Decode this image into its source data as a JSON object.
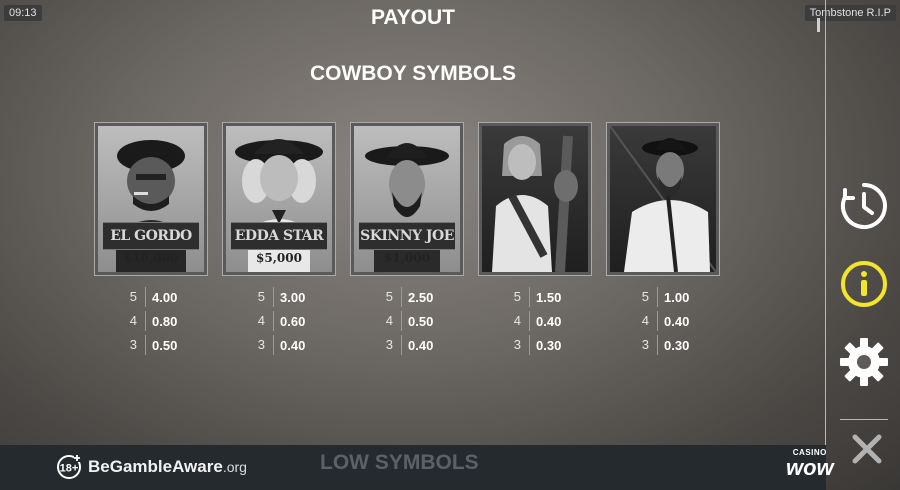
{
  "header": {
    "time": "09:13",
    "game_name": "Tombstone R.I.P",
    "title": "PAYOUT"
  },
  "section_title": "COWBOY SYMBOLS",
  "symbols": [
    {
      "name": "EL GORDO",
      "bounty": "$10,000",
      "pays": [
        {
          "count": "5",
          "value": "4.00"
        },
        {
          "count": "4",
          "value": "0.80"
        },
        {
          "count": "3",
          "value": "0.50"
        }
      ]
    },
    {
      "name": "EDDA STAR",
      "bounty": "$5,000",
      "pays": [
        {
          "count": "5",
          "value": "3.00"
        },
        {
          "count": "4",
          "value": "0.60"
        },
        {
          "count": "3",
          "value": "0.40"
        }
      ]
    },
    {
      "name": "SKINNY JOE",
      "bounty": "$1,000",
      "pays": [
        {
          "count": "5",
          "value": "2.50"
        },
        {
          "count": "4",
          "value": "0.50"
        },
        {
          "count": "3",
          "value": "0.40"
        }
      ]
    },
    {
      "name": "",
      "bounty": "",
      "pays": [
        {
          "count": "5",
          "value": "1.50"
        },
        {
          "count": "4",
          "value": "0.40"
        },
        {
          "count": "3",
          "value": "0.30"
        }
      ]
    },
    {
      "name": "",
      "bounty": "",
      "pays": [
        {
          "count": "5",
          "value": "1.00"
        },
        {
          "count": "4",
          "value": "0.40"
        },
        {
          "count": "3",
          "value": "0.30"
        }
      ]
    }
  ],
  "sidebar": {
    "icons": [
      "clock-history-icon",
      "info-icon",
      "settings-gear-icon",
      "close-icon"
    ],
    "info_color": "#f2e52b"
  },
  "footer": {
    "age_badge": "18+",
    "gamble_aware": "BeGambleAware",
    "gamble_aware_suffix": ".org",
    "next_section": "LOW SYMBOLS",
    "brand_top": "CASINO",
    "brand_main": "wow"
  }
}
